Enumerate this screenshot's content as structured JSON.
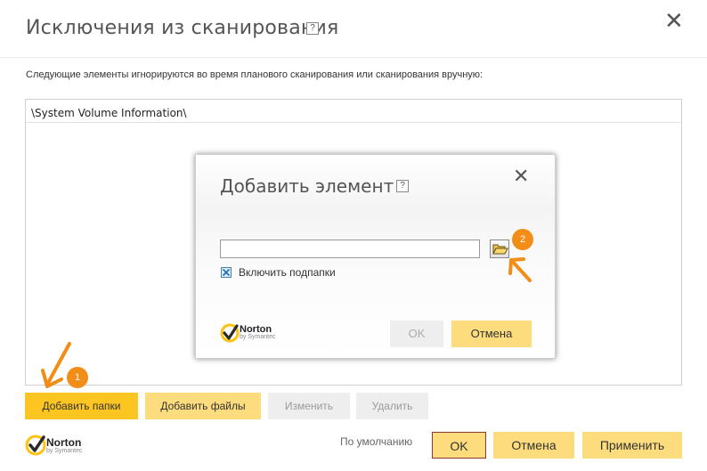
{
  "window": {
    "title": "Исключения из сканирования",
    "help_label": "?",
    "close_label": "✕",
    "description": "Следующие элементы игнорируются во время планового сканирования или сканирования вручную:"
  },
  "exclusions": {
    "items": [
      "\\System Volume Information\\"
    ]
  },
  "actions": {
    "add_folders": "Добавить папки",
    "add_files": "Добавить файлы",
    "edit": "Изменить",
    "delete": "Удалить"
  },
  "footer": {
    "brand": "Norton",
    "brand_sub": "by Symantec",
    "defaults_link": "По умолчанию",
    "ok": "OK",
    "cancel": "Отмена",
    "apply": "Применить"
  },
  "dialog": {
    "title": "Добавить элемент",
    "help_label": "?",
    "close_label": "✕",
    "path_value": "",
    "include_subfolders_label": "Включить подпапки",
    "include_subfolders_checked": true,
    "ok": "OK",
    "cancel": "Отмена",
    "brand": "Norton",
    "brand_sub": "by Symantec"
  },
  "annotations": {
    "step1": "1",
    "step2": "2",
    "color": "#f28d18"
  },
  "colors": {
    "primary_button": "#fcc522",
    "secondary_button": "#fcdc7c",
    "disabled_button": "#eeeeee",
    "ok_border": "#8b3a2b",
    "norton_yellow": "#ffc20e"
  }
}
